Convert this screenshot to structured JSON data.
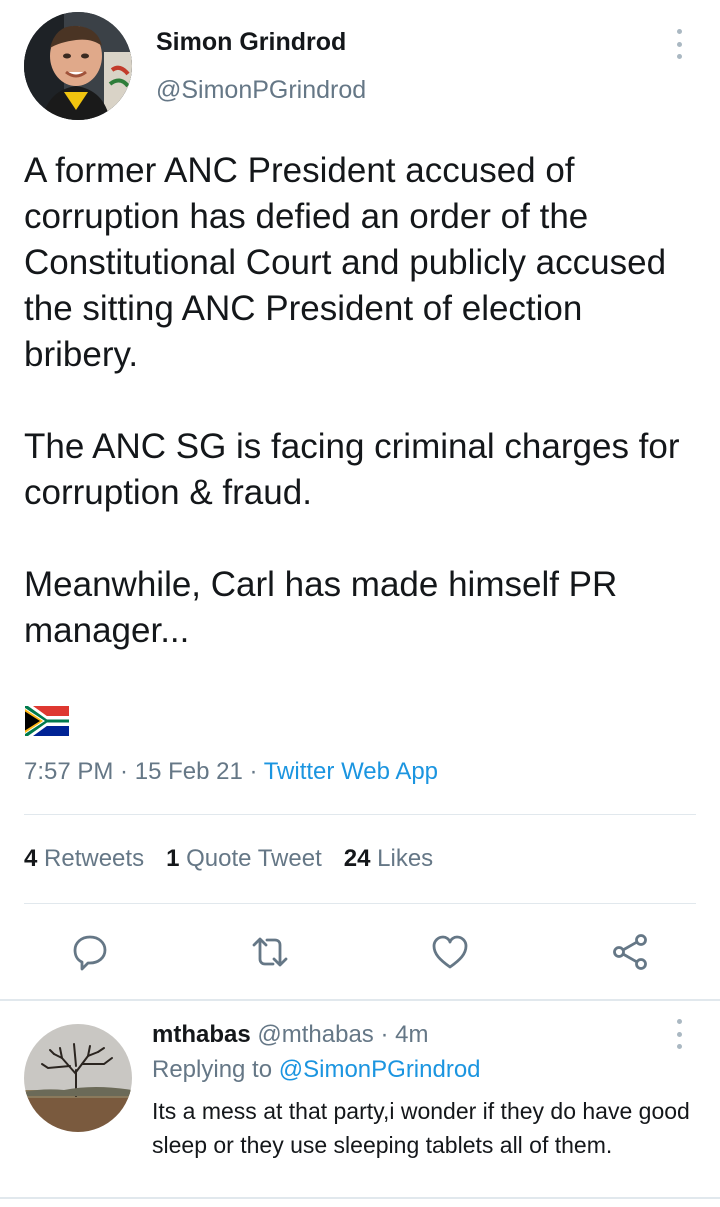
{
  "tweet": {
    "author_name": "Simon Grindrod",
    "author_handle": "@SimonPGrindrod",
    "paragraphs": [
      "A former ANC President accused of corruption has defied an order of the Constitutional Court and publicly accused the sitting ANC President of election bribery.",
      "The ANC SG is facing criminal charges for corruption & fraud.",
      "Meanwhile, Carl has made himself PR manager..."
    ],
    "emoji": "south-africa-flag",
    "time": "7:57 PM",
    "date": "15 Feb 21",
    "source": "Twitter Web App",
    "sep": " · "
  },
  "stats": {
    "retweets_count": "4",
    "retweets_label": "Retweets",
    "quotes_count": "1",
    "quotes_label": "Quote Tweet",
    "likes_count": "24",
    "likes_label": "Likes"
  },
  "actions": [
    "reply-icon",
    "retweet-icon",
    "like-icon",
    "share-icon"
  ],
  "reply": {
    "name": "mthabas",
    "handle": "@mthabas",
    "sep": " · ",
    "time": "4m",
    "replying_prefix": "Replying to",
    "replying_to": "@SimonPGrindrod",
    "text": "Its a mess at that party,i wonder if they do have good sleep or they use sleeping tablets all of them."
  },
  "colors": {
    "text": "#14171a",
    "secondary": "#657786",
    "link": "#1b95e0",
    "divider": "#e1e8ed"
  }
}
